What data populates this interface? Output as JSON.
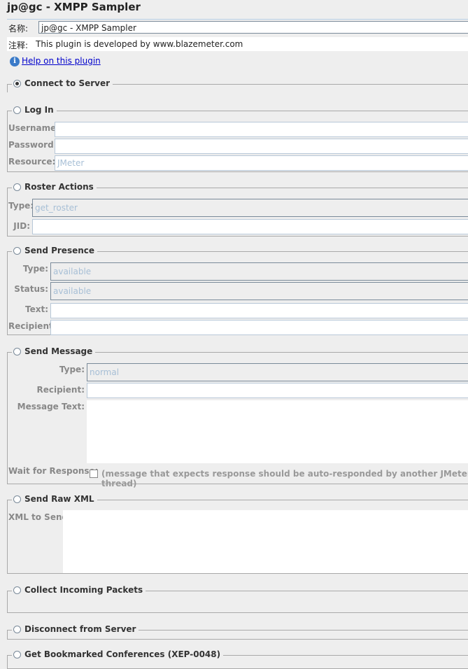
{
  "title": "jp@gc - XMPP Sampler",
  "name_label": "名称:",
  "name_value": "jp@gc - XMPP Sampler",
  "comment_label": "注释:",
  "comment_value": "This plugin is developed by www.blazemeter.com",
  "help_link": "Help on this plugin",
  "sections": {
    "connect": {
      "label": "Connect to Server",
      "selected": true
    },
    "login": {
      "label": "Log In",
      "username_label": "Username:",
      "password_label": "Password:",
      "resource_label": "Resource:",
      "resource_placeholder": "JMeter"
    },
    "roster": {
      "label": "Roster Actions",
      "type_label": "Type:",
      "type_value": "get_roster",
      "jid_label": "JID:"
    },
    "presence": {
      "label": "Send Presence",
      "type_label": "Type:",
      "type_value": "available",
      "status_label": "Status:",
      "status_value": "available",
      "text_label": "Text:",
      "recipient_label": "Recipient:"
    },
    "message": {
      "label": "Send Message",
      "type_label": "Type:",
      "type_value": "normal",
      "recipient_label": "Recipient:",
      "text_label": "Message Text:",
      "wait_label": "Wait for Response:",
      "wait_hint": "(message that expects response should be auto-responded by another JMeter thread)"
    },
    "raw": {
      "label": "Send Raw XML",
      "xml_label": "XML to Send:"
    },
    "collect": {
      "label": "Collect Incoming Packets"
    },
    "disconnect": {
      "label": "Disconnect from Server"
    },
    "bookmarks": {
      "label": "Get Bookmarked Conferences (XEP-0048)"
    }
  }
}
